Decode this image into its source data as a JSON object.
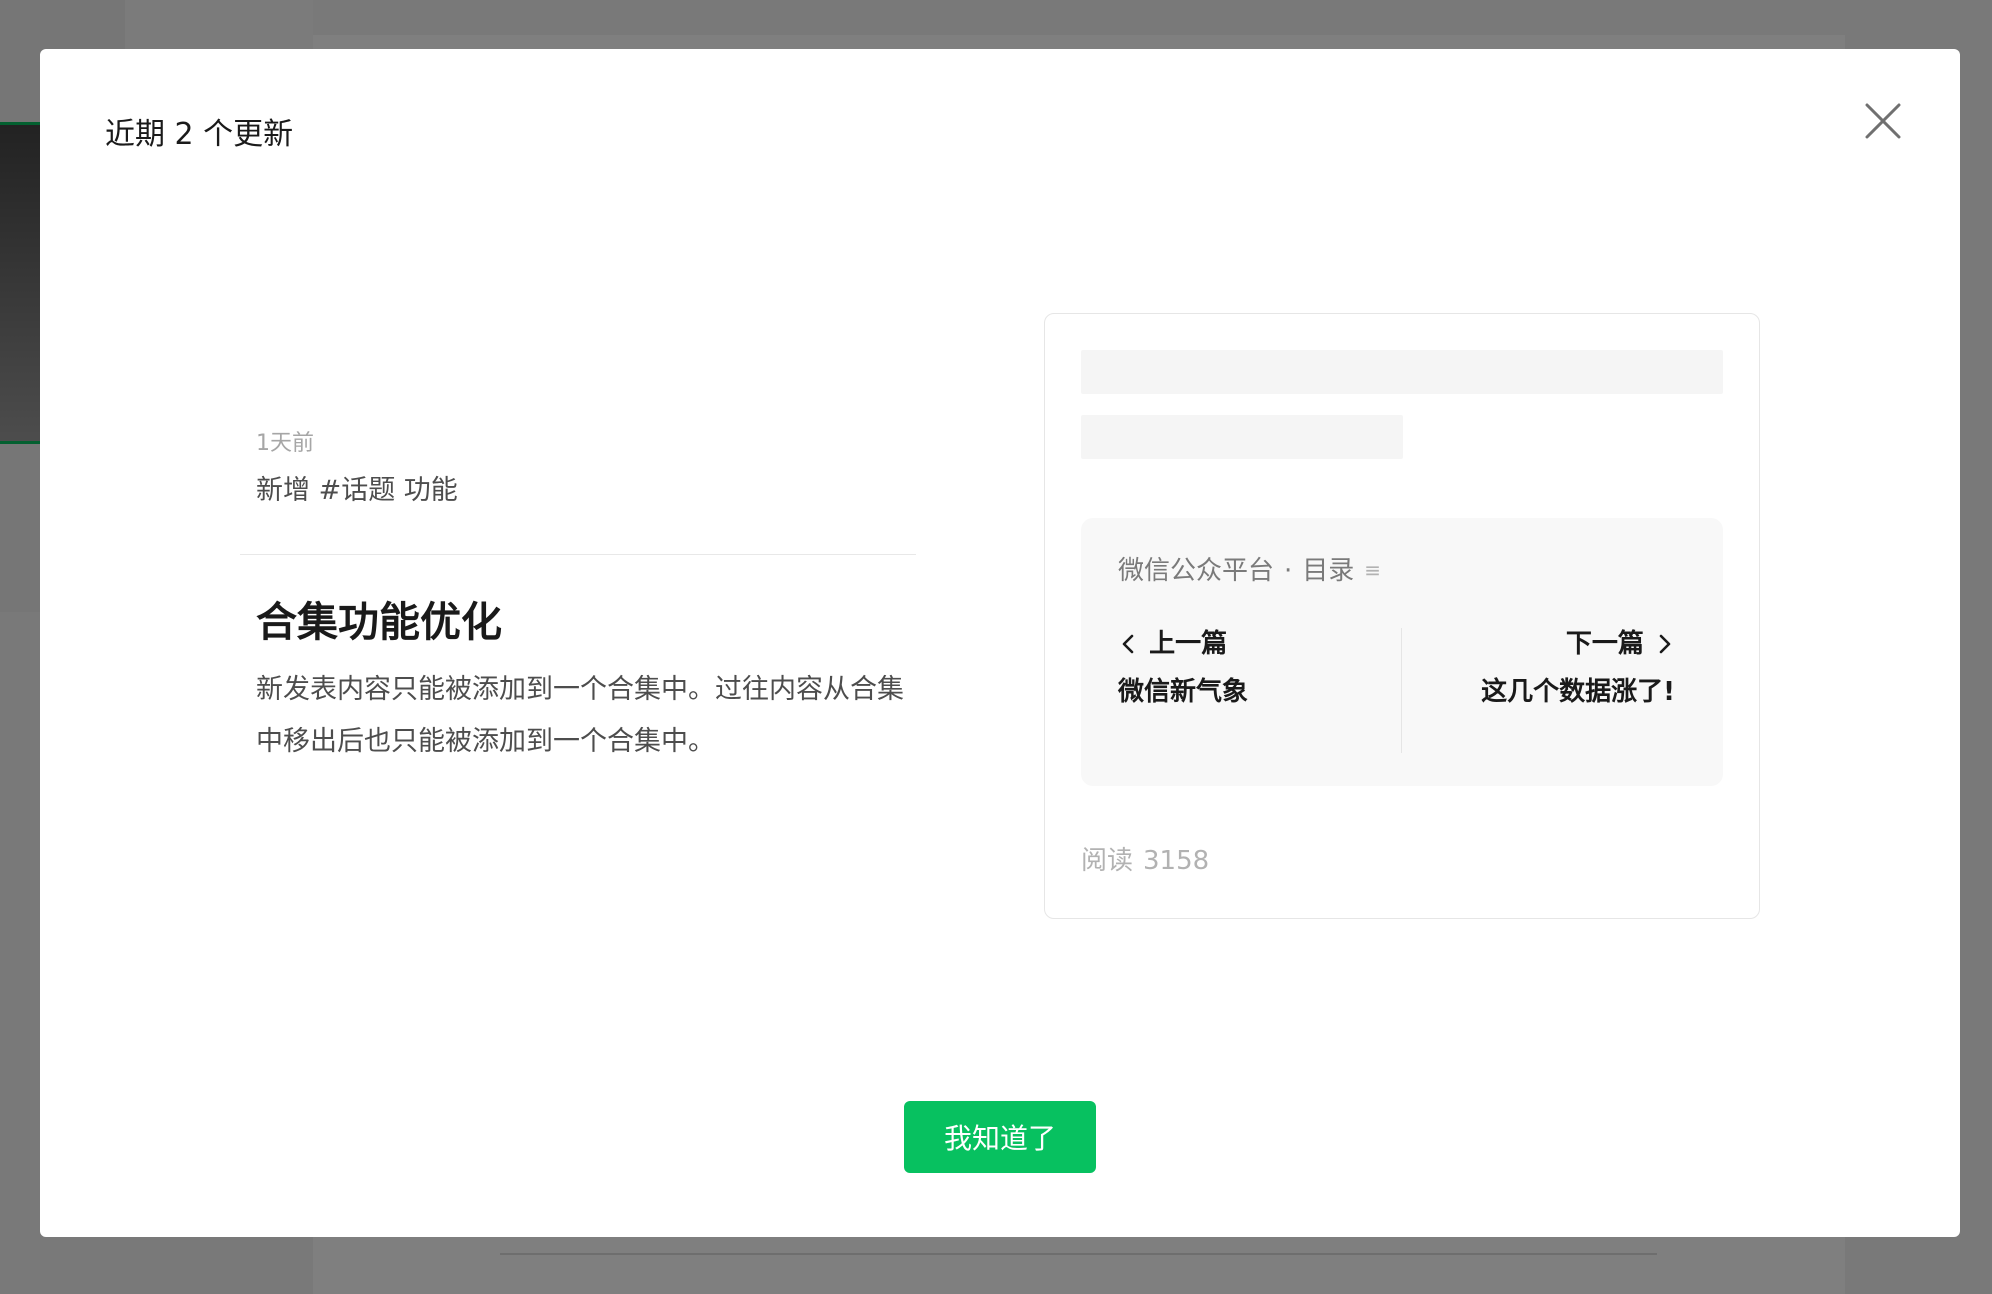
{
  "dialog": {
    "title": "近期 2 个更新",
    "confirm_label": "我知道了"
  },
  "updates": [
    {
      "time": "1天前",
      "description": "新增 #话题 功能"
    },
    {
      "title": "合集功能优化",
      "body": "新发表内容只能被添加到一个合集中。过往内容从合集中移出后也只能被添加到一个合集中。"
    }
  ],
  "preview": {
    "album_account": "微信公众平台",
    "album_separator": "·",
    "album_label": "目录",
    "menu_glyph": "≡",
    "prev_label": "上一篇",
    "prev_article": "微信新气象",
    "next_label": "下一篇",
    "next_article": "这几个数据涨了!",
    "read_label": "阅读",
    "read_count": "3158"
  },
  "colors": {
    "accent": "#07c160",
    "overlay": "rgba(0,0,0,0.5)"
  },
  "icons": {
    "close": "close-icon",
    "prev": "chevron-left-icon",
    "next": "chevron-right-icon",
    "menu": "menu-lines-icon"
  }
}
